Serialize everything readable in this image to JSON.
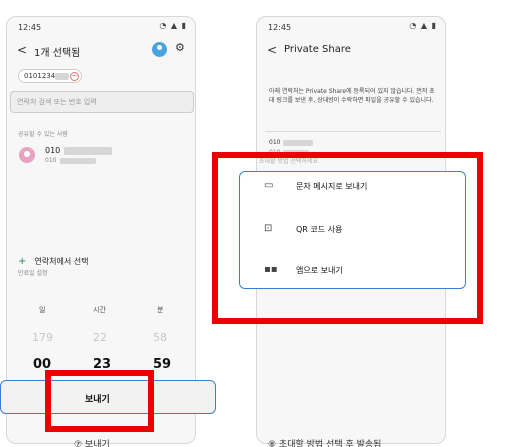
{
  "left_screen": {
    "status": {
      "time": "12:45"
    },
    "header": {
      "title": "1개 선택됨"
    },
    "chip": {
      "number_prefix": "0101234"
    },
    "search": {
      "placeholder": "연락처 검색 또는 번호 입력"
    },
    "share_section_label": "공유할 수 있는 사람",
    "contact": {
      "number": "010",
      "sub": "010"
    },
    "add_contact_label": "연락처에서 선택",
    "expiry_label": "만료일 설정",
    "picker": {
      "headers": [
        "일",
        "시간",
        "분"
      ],
      "dim": [
        "179",
        "22",
        "58"
      ],
      "selected": [
        "00",
        "23",
        "59"
      ]
    },
    "send_label": "보내기",
    "caption": "⑦ 보내기"
  },
  "right_screen": {
    "status": {
      "time": "12:45"
    },
    "header": {
      "title": "Private Share"
    },
    "description": "아래 연락처는 Private Share에 등록되어 있지 않습니다. 먼저 초대 링크를 보낸 후, 상대방이 수락하면 파일을 공유할 수 있습니다.",
    "number_row": "010",
    "number_sub": "010",
    "faint_label": "초대할 방법 선택하세요",
    "options": [
      {
        "icon": "message-icon",
        "label": "문자 메시지로 보내기"
      },
      {
        "icon": "qr-code-icon",
        "label": "QR 코드 사용"
      },
      {
        "icon": "app-grid-icon",
        "label": "앱으로 보내기"
      }
    ],
    "caption": "⑧ 초대할 방법 선택 후 발송됨"
  },
  "colors": {
    "highlight_red": "#ee0000",
    "focus_blue": "#3e7dd6"
  }
}
